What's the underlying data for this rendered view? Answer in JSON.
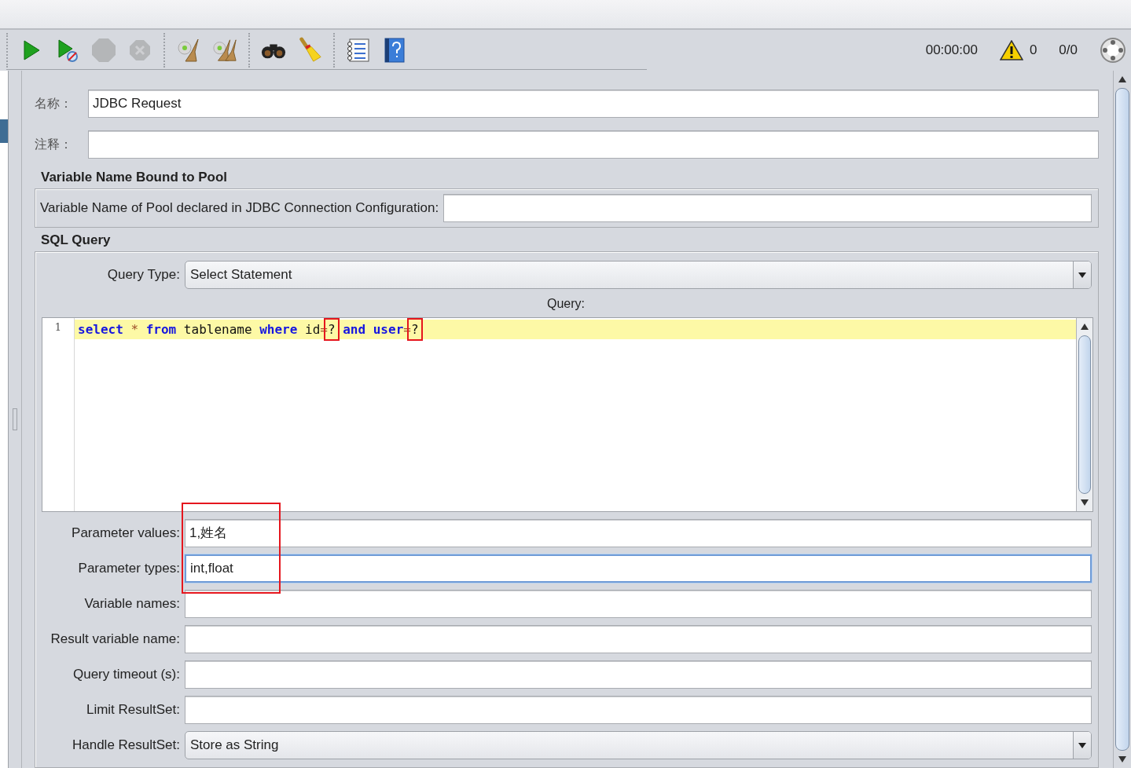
{
  "toolbar": {
    "groups": [
      [
        {
          "kind": "start",
          "disabled": false
        },
        {
          "kind": "start-no-pauses",
          "disabled": false
        },
        {
          "kind": "stop",
          "disabled": true
        },
        {
          "kind": "shutdown",
          "disabled": true
        }
      ],
      [
        {
          "kind": "clear",
          "disabled": false
        },
        {
          "kind": "clear-all",
          "disabled": false
        }
      ],
      [
        {
          "kind": "search",
          "disabled": false
        },
        {
          "kind": "reset",
          "disabled": false
        }
      ],
      [
        {
          "kind": "functions",
          "disabled": false
        },
        {
          "kind": "help",
          "disabled": false
        }
      ]
    ],
    "timer": "00:00:00",
    "warnings": "0",
    "threads": "0/0"
  },
  "name": {
    "label": "名称：",
    "value": "JDBC Request"
  },
  "comments": {
    "label": "注释："
  },
  "pool": {
    "title": "Variable Name Bound to Pool",
    "label": "Variable Name of Pool declared in JDBC Connection Configuration:"
  },
  "sql": {
    "title": "SQL Query",
    "query_type": {
      "label": "Query Type:",
      "value": "Select Statement"
    },
    "query_caption": "Query:",
    "editor": {
      "line_number": "1",
      "tokens": [
        {
          "kind": "keyword",
          "text": "select ",
          "highlighted": false
        },
        {
          "kind": "operator",
          "text": "* ",
          "highlighted": false
        },
        {
          "kind": "keyword",
          "text": "from",
          "highlighted": false
        },
        {
          "kind": "plain",
          "text": " tablename ",
          "highlighted": false
        },
        {
          "kind": "keyword",
          "text": "where",
          "highlighted": false
        },
        {
          "kind": "plain",
          "text": " id",
          "highlighted": false
        },
        {
          "kind": "operator",
          "text": "=",
          "highlighted": false
        },
        {
          "kind": "plain",
          "text": "?",
          "highlighted": true
        },
        {
          "kind": "keyword",
          "text": " and user",
          "highlighted": false
        },
        {
          "kind": "operator",
          "text": "=",
          "highlighted": false
        },
        {
          "kind": "plain",
          "text": "?",
          "highlighted": true
        }
      ]
    },
    "params": [
      {
        "kind": "text",
        "label": "Parameter values:",
        "value": "1,姓名",
        "focused": false,
        "highlighted": true
      },
      {
        "kind": "text",
        "label": "Parameter types:",
        "value": "int,float",
        "focused": true,
        "highlighted": true
      },
      {
        "kind": "text",
        "label": "Variable names:",
        "focused": false
      },
      {
        "kind": "text",
        "label": "Result variable name:",
        "focused": false
      },
      {
        "kind": "text",
        "label": "Query timeout (s):",
        "focused": false
      },
      {
        "kind": "text",
        "label": "Limit ResultSet:",
        "focused": false
      },
      {
        "kind": "select",
        "label": "Handle ResultSet:",
        "value": "Store as String"
      }
    ]
  }
}
